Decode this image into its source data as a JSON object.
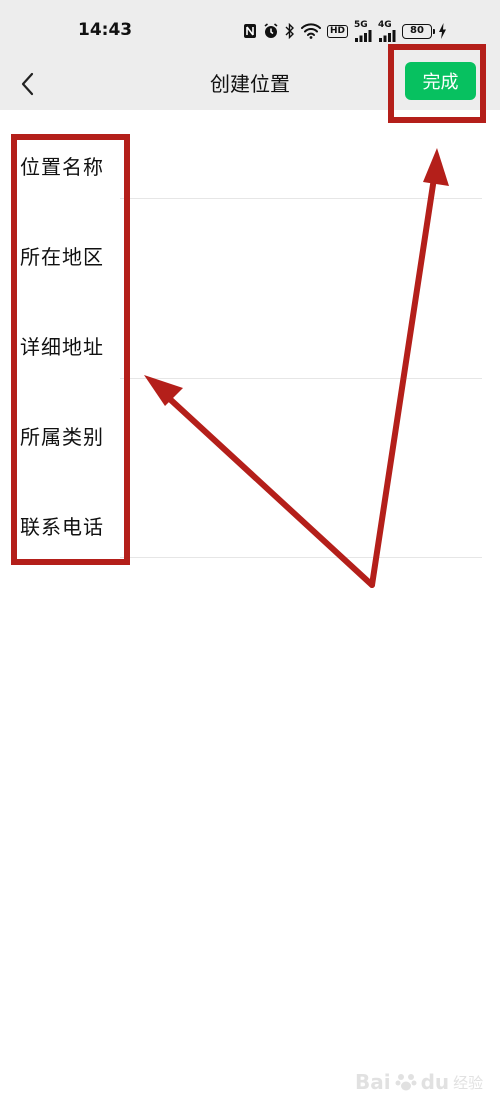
{
  "status_bar": {
    "time": "14:43",
    "net_1": "5G",
    "net_2": "4G",
    "hd": "HD",
    "battery": "80",
    "icons": [
      "nfc-icon",
      "alarm-icon",
      "bluetooth-icon",
      "wifi-icon",
      "hd-icon",
      "signal-icon",
      "signal-icon",
      "battery-icon",
      "charging-icon"
    ]
  },
  "nav": {
    "back_icon": "chevron-left-icon",
    "title": "创建位置",
    "done_label": "完成",
    "done_color": "#07c160"
  },
  "form": {
    "fields": [
      {
        "label": "位置名称"
      },
      {
        "label": "所在地区"
      },
      {
        "label": "详细地址"
      },
      {
        "label": "所属类别"
      },
      {
        "label": "联系电话"
      }
    ]
  },
  "annotation": {
    "color": "#b41f1a"
  },
  "watermark": {
    "brand": "Bai",
    "brand_tail": "du",
    "sub": "经验"
  }
}
